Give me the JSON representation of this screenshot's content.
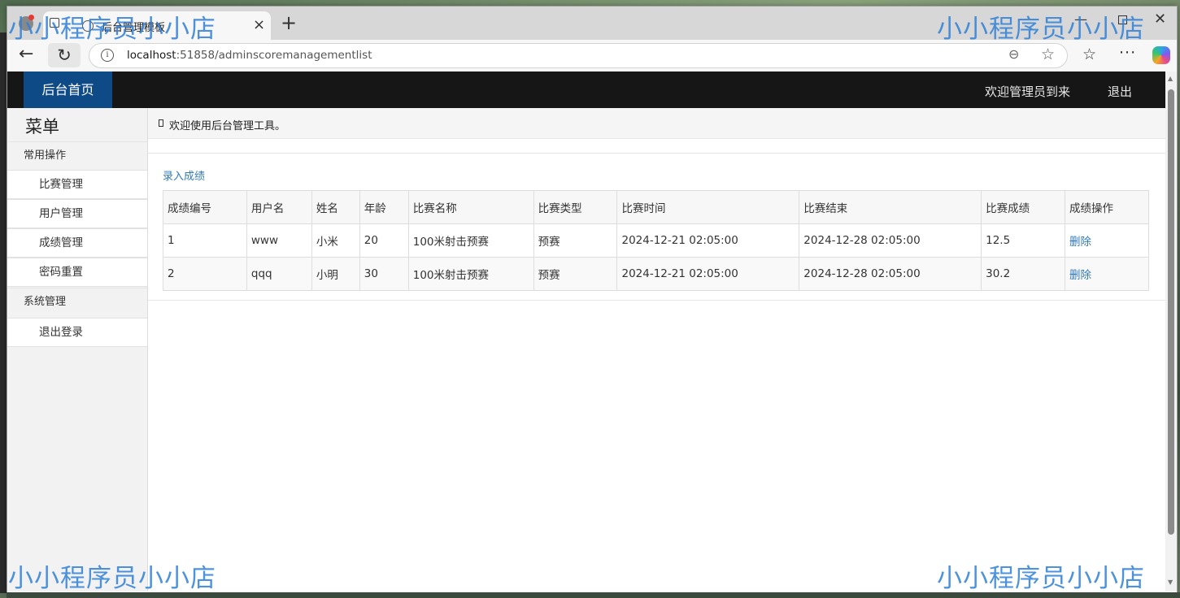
{
  "browser": {
    "tab_title": "后台管理模板",
    "new_tab_symbol": "+",
    "tab_close_symbol": "×",
    "url_host": "localhost",
    "url_rest": ":51858/adminscoremanagementlist",
    "icons": [
      "profile-icon",
      "tab-actions-icon",
      "favicon-globe-icon",
      "back-arrow-icon",
      "reload-icon",
      "site-info-icon",
      "zoom-icon",
      "star-icon",
      "favorites-icon",
      "more-icon",
      "copilot-icon"
    ]
  },
  "header": {
    "brand": "后台首页",
    "welcome": "欢迎管理员到来",
    "logout": "退出",
    "colors": {
      "bar": "#161616",
      "brand_bg": "#0e4a85"
    }
  },
  "sidebar": {
    "title": "菜单",
    "groups": [
      {
        "label": "常用操作",
        "items": [
          "比赛管理",
          "用户管理",
          "成绩管理",
          "密码重置"
        ]
      },
      {
        "label": "系统管理",
        "items": [
          "退出登录"
        ]
      }
    ]
  },
  "notice": {
    "text": "欢迎使用后台管理工具。"
  },
  "main": {
    "add_link": "录入成绩",
    "link_color": "#337ab7",
    "columns": [
      "成绩编号",
      "用户名",
      "姓名",
      "年龄",
      "比赛名称",
      "比赛类型",
      "比赛时间",
      "比赛结束",
      "比赛成绩",
      "成绩操作"
    ],
    "rows": [
      [
        "1",
        "www",
        "小米",
        "20",
        "100米射击预赛",
        "预赛",
        "2024-12-21 02:05:00",
        "2024-12-28 02:05:00",
        "12.5",
        "删除"
      ],
      [
        "2",
        "qqq",
        "小明",
        "30",
        "100米射击预赛",
        "预赛",
        "2024-12-21 02:05:00",
        "2024-12-28 02:05:00",
        "30.2",
        "删除"
      ]
    ]
  },
  "watermark": "小小程序员小小店"
}
